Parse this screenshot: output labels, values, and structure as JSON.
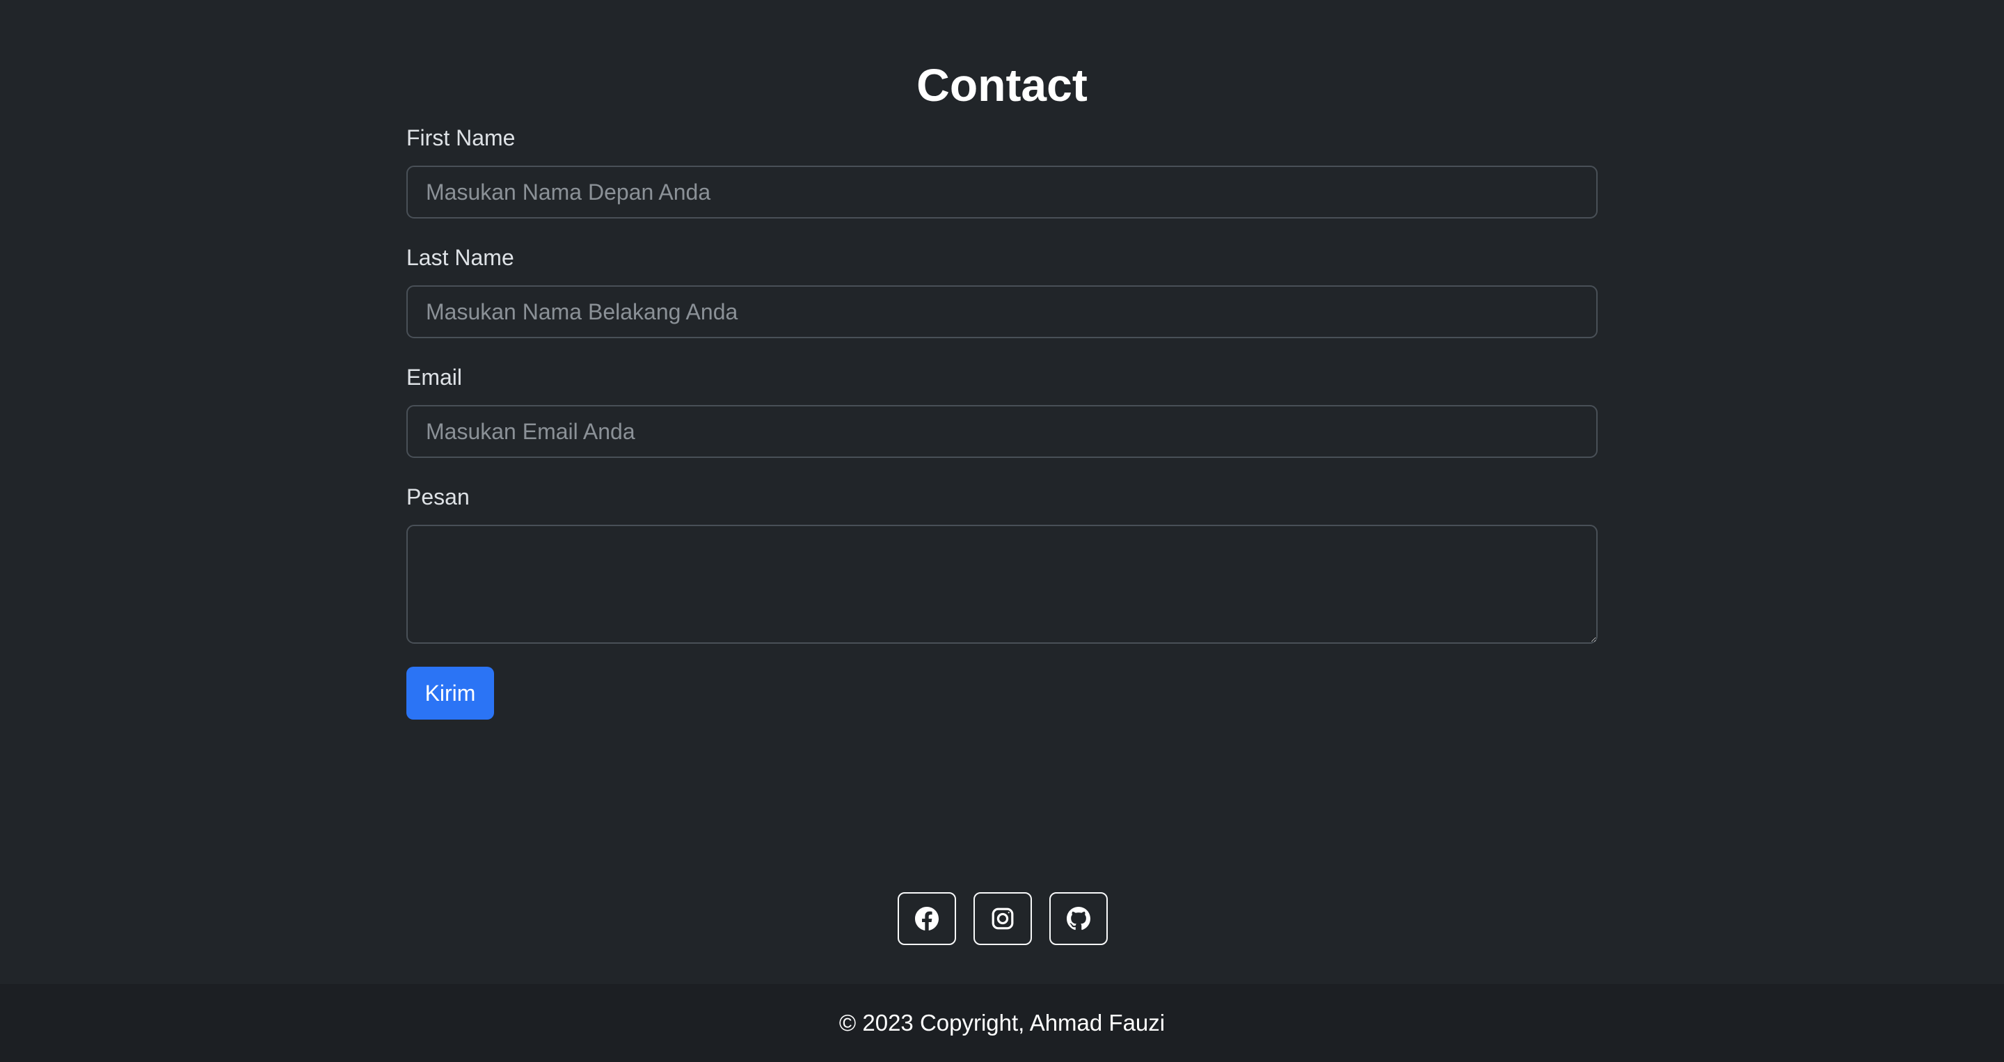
{
  "page": {
    "title": "Contact"
  },
  "form": {
    "first_name": {
      "label": "First Name",
      "placeholder": "Masukan Nama Depan Anda",
      "value": ""
    },
    "last_name": {
      "label": "Last Name",
      "placeholder": "Masukan Nama Belakang Anda",
      "value": ""
    },
    "email": {
      "label": "Email",
      "placeholder": "Masukan Email Anda",
      "value": ""
    },
    "message": {
      "label": "Pesan",
      "value": ""
    },
    "submit_label": "Kirim"
  },
  "social": {
    "icons": [
      "facebook-icon",
      "instagram-icon",
      "github-icon"
    ]
  },
  "footer": {
    "copyright": "© 2023 Copyright, Ahmad Fauzi"
  },
  "colors": {
    "background": "#212529",
    "footer_background": "#1c1f23",
    "primary_button": "#2b74f5",
    "input_border": "#495057"
  }
}
